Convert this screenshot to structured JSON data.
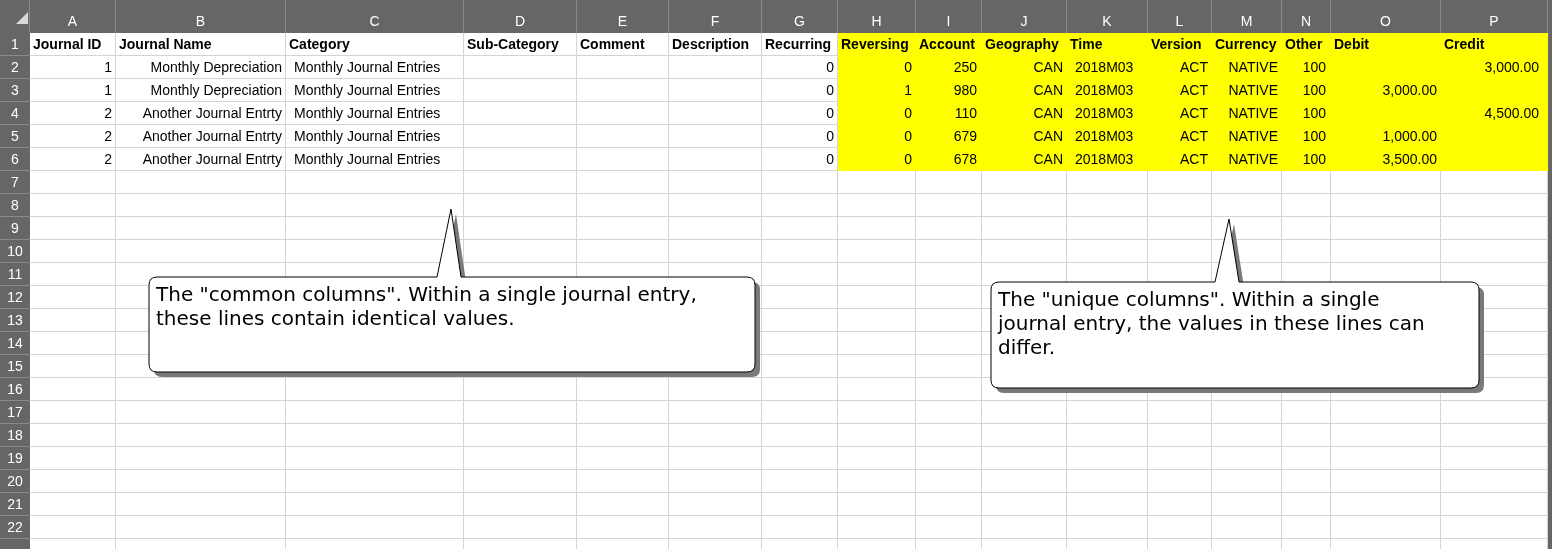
{
  "columns": [
    {
      "letter": "A",
      "highlighted": false
    },
    {
      "letter": "B",
      "highlighted": false
    },
    {
      "letter": "C",
      "highlighted": false
    },
    {
      "letter": "D",
      "highlighted": false
    },
    {
      "letter": "E",
      "highlighted": false
    },
    {
      "letter": "F",
      "highlighted": false
    },
    {
      "letter": "G",
      "highlighted": false
    },
    {
      "letter": "H",
      "highlighted": true
    },
    {
      "letter": "I",
      "highlighted": true
    },
    {
      "letter": "J",
      "highlighted": true
    },
    {
      "letter": "K",
      "highlighted": true
    },
    {
      "letter": "L",
      "highlighted": true
    },
    {
      "letter": "M",
      "highlighted": true
    },
    {
      "letter": "N",
      "highlighted": true
    },
    {
      "letter": "O",
      "highlighted": true
    },
    {
      "letter": "P",
      "highlighted": true
    }
  ],
  "header_row": {
    "number": "1",
    "cells": [
      "Journal ID",
      "Journal Name",
      "Category",
      "Sub-Category",
      "Comment",
      "Description",
      "Recurring",
      "Reversing",
      "Account",
      "Geography",
      "Time",
      "Version",
      "Currency",
      "Other",
      "Debit",
      "Credit"
    ]
  },
  "rows": [
    {
      "number": "2",
      "cells": [
        "1",
        "Monthly Depreciation",
        "Monthly Journal Entries",
        null,
        null,
        null,
        "0",
        "0",
        "250",
        "CAN",
        "2018M03",
        "ACT",
        "NATIVE",
        "100",
        null,
        "3,000.00"
      ]
    },
    {
      "number": "3",
      "cells": [
        "1",
        "Monthly Depreciation",
        "Monthly Journal Entries",
        null,
        null,
        null,
        "0",
        "1",
        "980",
        "CAN",
        "2018M03",
        "ACT",
        "NATIVE",
        "100",
        "3,000.00",
        null
      ]
    },
    {
      "number": "4",
      "cells": [
        "2",
        "Another Journal Entrty",
        "Monthly Journal Entries",
        null,
        null,
        null,
        "0",
        "0",
        "110",
        "CAN",
        "2018M03",
        "ACT",
        "NATIVE",
        "100",
        null,
        "4,500.00"
      ]
    },
    {
      "number": "5",
      "cells": [
        "2",
        "Another Journal Entrty",
        "Monthly Journal Entries",
        null,
        null,
        null,
        "0",
        "0",
        "679",
        "CAN",
        "2018M03",
        "ACT",
        "NATIVE",
        "100",
        "1,000.00",
        null
      ]
    },
    {
      "number": "6",
      "cells": [
        "2",
        "Another Journal Entrty",
        "Monthly Journal Entries",
        null,
        null,
        null,
        "0",
        "0",
        "678",
        "CAN",
        "2018M03",
        "ACT",
        "NATIVE",
        "100",
        "3,500.00",
        null
      ]
    }
  ],
  "empty_rows": [
    "7",
    "8",
    "9",
    "10",
    "11",
    "12",
    "13",
    "14",
    "15",
    "16",
    "17",
    "18",
    "19",
    "20",
    "21",
    "22"
  ],
  "callouts": [
    {
      "text": "The \"common columns\". Within a single journal entry, these lines contain identical values."
    },
    {
      "text": "The \"unique columns\". Within a single journal entry, the values in these lines can differ."
    }
  ]
}
